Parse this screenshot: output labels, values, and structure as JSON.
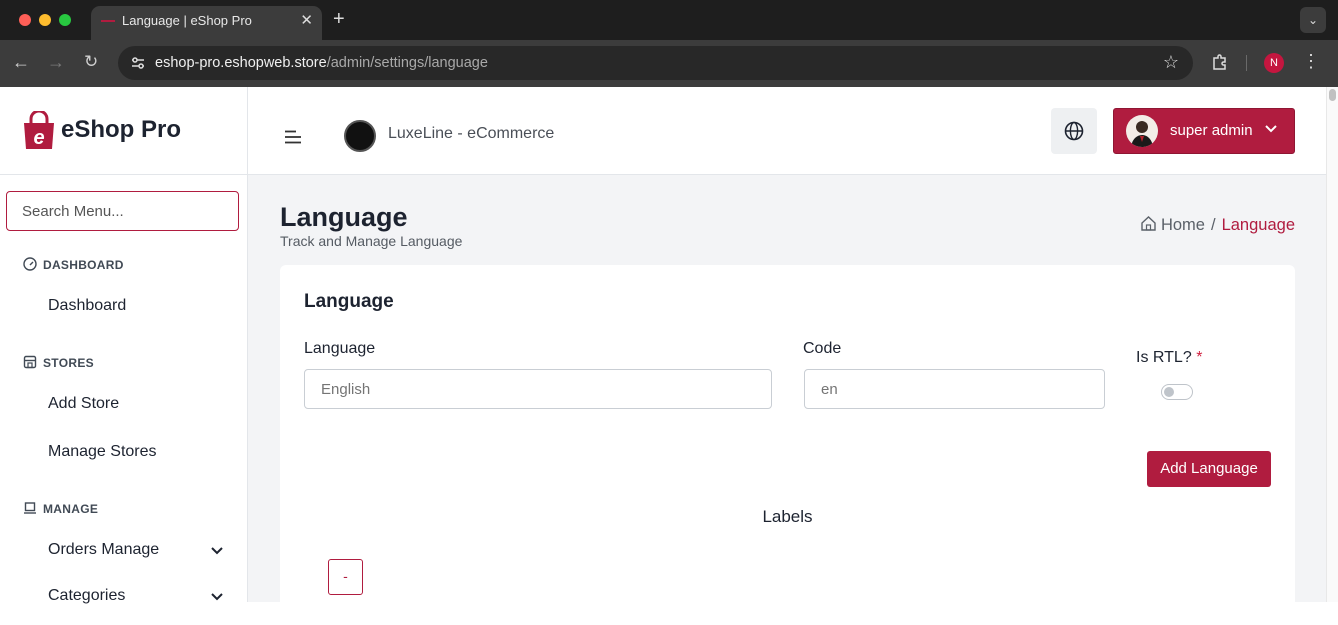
{
  "browser": {
    "tab_title": "Language | eShop Pro",
    "tab_close": "✕",
    "new_tab": "+",
    "url_host": "eshop-pro.eshopweb.store",
    "url_path": "/admin/settings/language",
    "profile_initial": "N"
  },
  "brand": {
    "name": "eShop Pro",
    "color": "#b01c3f"
  },
  "sidebar": {
    "search_placeholder": "Search Menu...",
    "sections": [
      {
        "title": "DASHBOARD",
        "icon": "gauge-icon",
        "items": [
          {
            "label": "Dashboard"
          }
        ]
      },
      {
        "title": "STORES",
        "icon": "store-icon",
        "items": [
          {
            "label": "Add Store"
          },
          {
            "label": "Manage Stores"
          }
        ]
      },
      {
        "title": "MANAGE",
        "icon": "laptop-icon",
        "items": [
          {
            "label": "Orders Manage",
            "has_submenu": true
          },
          {
            "label": "Categories",
            "has_submenu": true
          }
        ]
      }
    ]
  },
  "header": {
    "store_name": "LuxeLine - eCommerce",
    "user_name": "super admin"
  },
  "page": {
    "title": "Language",
    "subtitle": "Track and Manage Language",
    "breadcrumb": {
      "home": "Home",
      "separator": "/",
      "current": "Language"
    }
  },
  "form": {
    "card_title": "Language",
    "language_label": "Language",
    "language_placeholder": "English",
    "code_label": "Code",
    "code_placeholder": "en",
    "rtl_label": "Is RTL?",
    "required_mark": "*",
    "rtl_enabled": false,
    "submit_label": "Add Language",
    "labels_heading": "Labels",
    "remove_label": "-"
  }
}
